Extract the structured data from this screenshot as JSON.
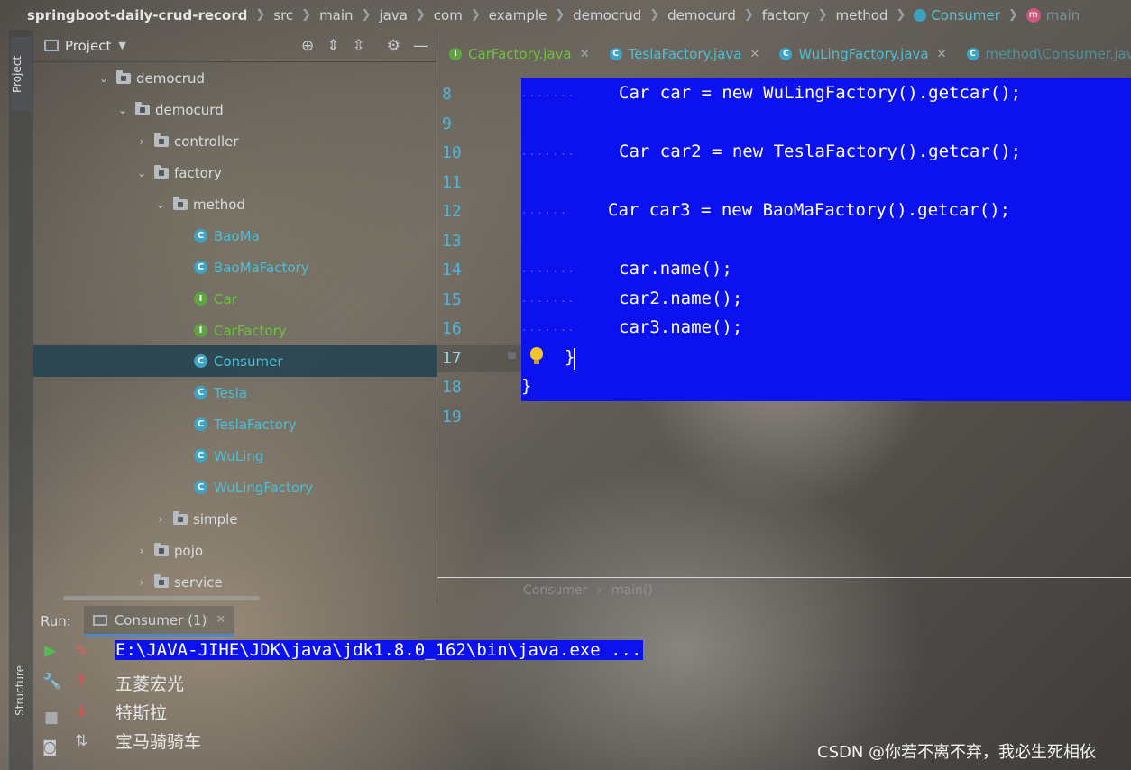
{
  "navbar": {
    "crumbs": [
      "springboot-daily-crud-record",
      "src",
      "main",
      "java",
      "com",
      "example",
      "democrud",
      "democurd",
      "factory",
      "method",
      "Consumer",
      "main"
    ]
  },
  "tool_windows": {
    "project_tab": "Project",
    "structure_tab": "Structure"
  },
  "project_panel": {
    "title": "Project",
    "tree": [
      {
        "label": "democrud",
        "kind": "folder",
        "expanded": true
      },
      {
        "label": "democurd",
        "kind": "folder",
        "expanded": true
      },
      {
        "label": "controller",
        "kind": "folder",
        "expanded": false
      },
      {
        "label": "factory",
        "kind": "folder",
        "expanded": true
      },
      {
        "label": "method",
        "kind": "folder",
        "expanded": true
      },
      {
        "label": "BaoMa",
        "kind": "class"
      },
      {
        "label": "BaoMaFactory",
        "kind": "class"
      },
      {
        "label": "Car",
        "kind": "interface"
      },
      {
        "label": "CarFactory",
        "kind": "interface"
      },
      {
        "label": "Consumer",
        "kind": "class",
        "selected": true
      },
      {
        "label": "Tesla",
        "kind": "class"
      },
      {
        "label": "TeslaFactory",
        "kind": "class"
      },
      {
        "label": "WuLing",
        "kind": "class"
      },
      {
        "label": "WuLingFactory",
        "kind": "class"
      },
      {
        "label": "simple",
        "kind": "folder",
        "expanded": false
      },
      {
        "label": "pojo",
        "kind": "folder",
        "expanded": false
      },
      {
        "label": "service",
        "kind": "folder",
        "expanded": false
      }
    ]
  },
  "editor": {
    "tabs": [
      {
        "label": "CarFactory.java",
        "kind": "interface"
      },
      {
        "label": "TeslaFactory.java",
        "kind": "class"
      },
      {
        "label": "WuLingFactory.java",
        "kind": "class"
      },
      {
        "label": "method\\Consumer.java",
        "kind": "class-partial"
      }
    ],
    "line_numbers": [
      "8",
      "9",
      "10",
      "11",
      "12",
      "13",
      "14",
      "15",
      "16",
      "17",
      "18",
      "19"
    ],
    "code_lines": [
      "Car car = new WuLingFactory().getcar();",
      "",
      "Car car2 = new TeslaFactory().getcar();",
      "",
      "Car car3 = new BaoMaFactory().getcar();",
      "",
      "car.name();",
      "car2.name();",
      "car3.name();",
      "}",
      "}",
      ""
    ],
    "breadcrumb": [
      "Consumer",
      "main()"
    ],
    "selection_color": "#0c12ee"
  },
  "run_panel": {
    "label": "Run:",
    "tab": "Consumer (1)",
    "console": [
      "E:\\JAVA-JIHE\\JDK\\java\\jdk1.8.0_162\\bin\\java.exe ...",
      "五菱宏光",
      "特斯拉",
      "宝马骑骑车"
    ]
  },
  "watermark": "CSDN @你若不离不弃，我必生死相依"
}
